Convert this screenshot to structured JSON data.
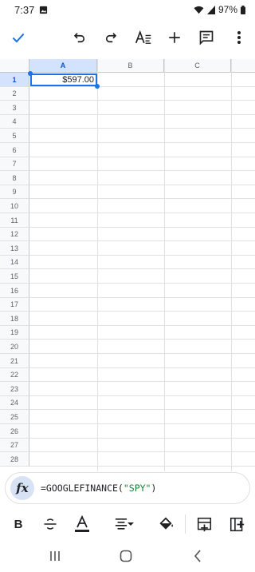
{
  "status_bar": {
    "time": "7:37",
    "battery": "97%"
  },
  "toolbar": {
    "icons": [
      "check-icon",
      "undo-icon",
      "redo-icon",
      "text-format-icon",
      "add-icon",
      "comment-icon",
      "more-vert-icon"
    ]
  },
  "sheet": {
    "columns": [
      "A",
      "B",
      "C"
    ],
    "rows": [
      "1",
      "2",
      "3",
      "4",
      "5",
      "6",
      "7",
      "8",
      "9",
      "10",
      "11",
      "12",
      "13",
      "14",
      "15",
      "16",
      "17",
      "18",
      "19",
      "20",
      "21",
      "22",
      "23",
      "24",
      "25",
      "26",
      "27",
      "28"
    ],
    "selected_cell": "A1",
    "cells": {
      "A1": "$597.00"
    }
  },
  "formula_bar": {
    "fx_label": "fx",
    "formula_prefix": "=GOOGLEFINANCE(",
    "formula_string": "\"SPY\"",
    "formula_suffix": ")"
  },
  "format_bar": {
    "bold_label": "B",
    "text_color_swatch": "#202124"
  },
  "colors": {
    "accent": "#1a73e8",
    "header_selected": "#d3e3fd"
  }
}
